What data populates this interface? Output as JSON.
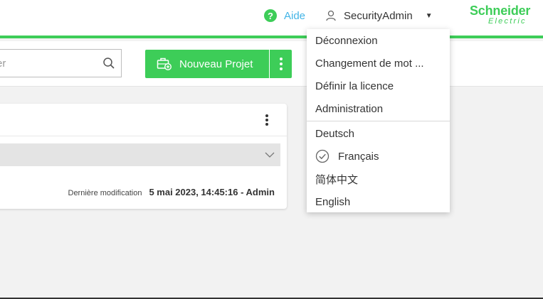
{
  "header": {
    "help_label": "Aide",
    "help_icon": "?",
    "user_label": "SecurityAdmin",
    "user_caret": "▼",
    "brand_line1": "Schneider",
    "brand_line2": "Electric"
  },
  "toolbar": {
    "search_placeholder": "er",
    "new_project_label": "Nouveau Projet"
  },
  "project_card": {
    "last_modified_label": "Dernière modification",
    "last_modified_value": "5 mai 2023, 14:45:16 - Admin"
  },
  "user_menu": {
    "items": [
      {
        "label": "Déconnexion"
      },
      {
        "label": "Changement de mot ..."
      },
      {
        "label": "Définir la licence"
      },
      {
        "label": "Administration"
      }
    ],
    "languages": [
      {
        "label": "Deutsch",
        "selected": false
      },
      {
        "label": "Français",
        "selected": true
      },
      {
        "label": "简体中文",
        "selected": false
      },
      {
        "label": "English",
        "selected": false
      }
    ]
  },
  "colors": {
    "accent": "#3dcd58",
    "link": "#42b4e6",
    "background": "#f2f2f2"
  }
}
